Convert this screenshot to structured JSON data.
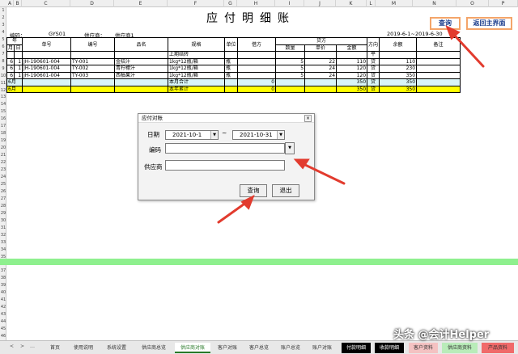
{
  "columns": [
    "A",
    "B",
    "C",
    "D",
    "E",
    "F",
    "G",
    "H",
    "I",
    "J",
    "K",
    "L",
    "M",
    "N",
    "O",
    "P"
  ],
  "rows": [
    "1",
    "2",
    "3",
    "4",
    "5",
    "6",
    "7",
    "8",
    "9",
    "10",
    "11",
    "12",
    "13",
    "14",
    "15",
    "16",
    "17",
    "18",
    "19",
    "20",
    "21",
    "22",
    "23",
    "24",
    "25",
    "26",
    "27",
    "28",
    "29",
    "30",
    "31",
    "32",
    "33",
    "34",
    "35",
    "36",
    "37",
    "38",
    "39",
    "40",
    "41",
    "42",
    "43",
    "44",
    "45",
    "46"
  ],
  "title": "应付明细账",
  "meta": {
    "code_label": "编码：",
    "code_value": "GYS01",
    "supplier_label": "供应商：",
    "supplier_value": "供应商1",
    "period": "2019-6-1~2019-6-30"
  },
  "buttons": {
    "query": "查询",
    "back_main": "返回主界面"
  },
  "table": {
    "h_year": "年",
    "h_month": "月",
    "h_day": "日",
    "h_doc_no": "单号",
    "h_item_no": "编号",
    "h_item_name": "品名",
    "h_spec": "规格",
    "h_unit": "单位",
    "h_debit": "借方",
    "h_credit": "贷方",
    "h_qty": "数量",
    "h_price": "单价",
    "h_amount": "金额",
    "h_direction": "方向",
    "h_balance": "余额",
    "h_note": "备注",
    "opening": {
      "label": "上期结转",
      "direction": "平"
    },
    "rows": [
      {
        "month": "6",
        "day": "1",
        "doc": "JH-190601-004",
        "code": "TY-001",
        "name": "金桔汁",
        "spec": "1kg*12瓶/箱",
        "unit": "瓶",
        "qty": "5",
        "price": "22",
        "amount": "110",
        "dir": "贷",
        "balance": "110"
      },
      {
        "month": "6",
        "day": "1",
        "doc": "JH-190601-004",
        "code": "TY-002",
        "name": "青柠檬汁",
        "spec": "1kg*12瓶/箱",
        "unit": "瓶",
        "qty": "5",
        "price": "24",
        "amount": "120",
        "dir": "贷",
        "balance": "230"
      },
      {
        "month": "6",
        "day": "1",
        "doc": "JH-190601-004",
        "code": "TY-003",
        "name": "西柚果汁",
        "spec": "1kg*12瓶/箱",
        "unit": "瓶",
        "qty": "5",
        "price": "24",
        "amount": "120",
        "dir": "贷",
        "balance": "350"
      }
    ],
    "month_total": {
      "month": "6月",
      "label": "本月合计",
      "debit": "0",
      "amount": "350",
      "dir": "贷",
      "balance": "350"
    },
    "year_total": {
      "month": "6月",
      "label": "本年累计",
      "debit": "0",
      "amount": "350",
      "dir": "贷",
      "balance": "350"
    }
  },
  "dialog": {
    "title": "应付对账",
    "close": "×",
    "date_label": "日期",
    "date_from": "2021-10-1",
    "tilde": "~",
    "date_to": "2021-10-31",
    "code_label": "编码",
    "supplier_label": "供应商",
    "query_btn": "查询",
    "exit_btn": "退出"
  },
  "tabs": [
    "首页",
    "使用说明",
    "系统设置",
    "供应商总览",
    "供应商对账",
    "客户对账",
    "客户总览",
    "账户总览",
    "账户对账",
    "付款明细",
    "收款明细",
    "客户资料",
    "供应商资料",
    "产品资料"
  ],
  "tab_nav": [
    "<",
    ">",
    "…"
  ],
  "watermark": "头条 @会计Helper",
  "colors": {
    "accent": "#f4a56a",
    "arrow": "#e23b2e",
    "month_row": "#d9f5f8",
    "year_row": "#ffff00",
    "green_bar": "#8ef08e"
  }
}
